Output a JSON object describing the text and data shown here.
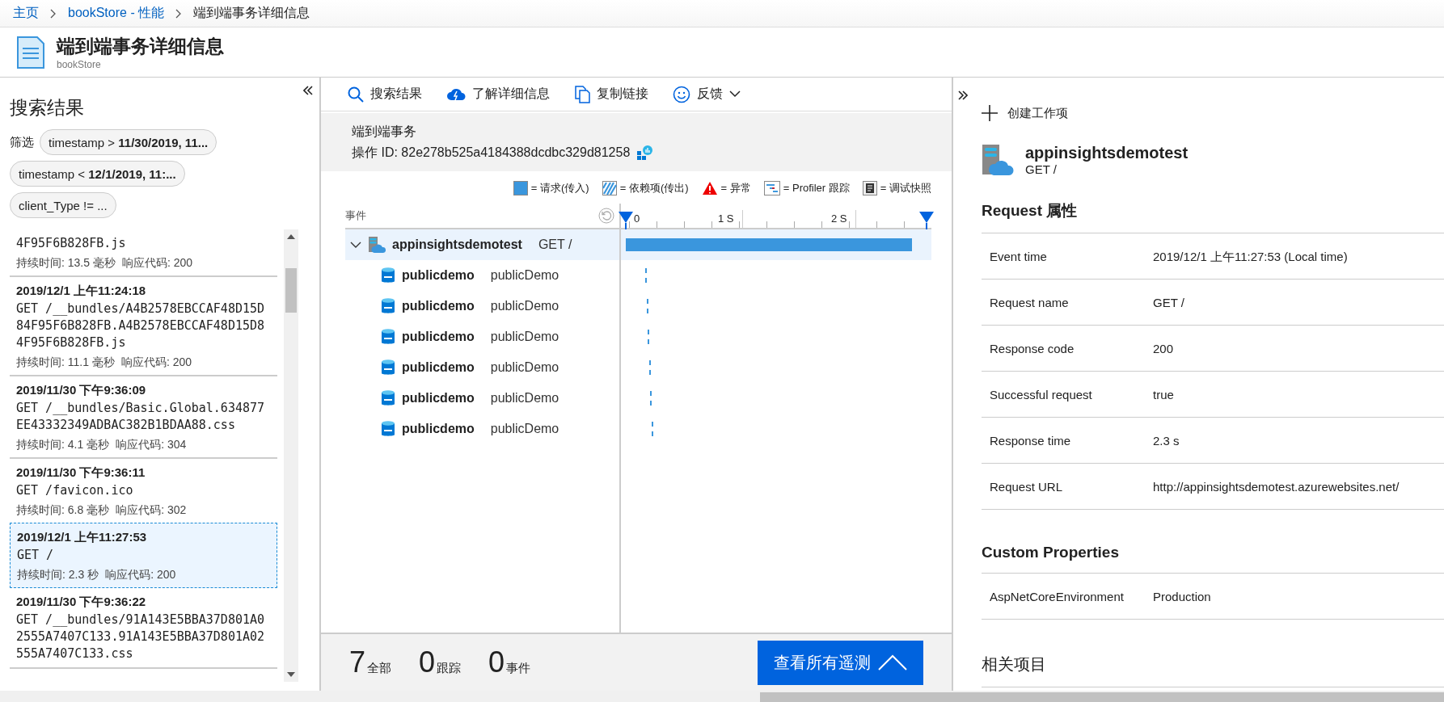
{
  "breadcrumb": [
    {
      "label": "主页",
      "kind": "link"
    },
    {
      "label": "bookStore - 性能",
      "kind": "link"
    },
    {
      "label": "端到端事务详细信息",
      "kind": "current"
    }
  ],
  "header": {
    "title": "端到端事务详细信息",
    "subtitle": "bookStore"
  },
  "search_panel": {
    "title": "搜索结果",
    "filter_label": "筛选",
    "filters": [
      "timestamp > **11/30/2019, 11...**",
      "timestamp < **12/1/2019, 11:...**",
      "client_Type != ..."
    ],
    "results": [
      {
        "request": "4F95F6B828FB.js",
        "duration": "持续时间: 13.5 毫秒",
        "code": "响应代码: 200",
        "selected": false
      },
      {
        "time": "2019/12/1 上午11:24:18",
        "request": "GET /__bundles/A4B2578EBCCAF48D15D84F95F6B828FB.A4B2578EBCCAF48D15D84F95F6B828FB.js",
        "duration": "持续时间: 11.1 毫秒",
        "code": "响应代码: 200",
        "selected": false
      },
      {
        "time": "2019/11/30 下午9:36:09",
        "request": "GET /__bundles/Basic.Global.634877EE43332349ADBAC382B1BDAA88.css",
        "duration": "持续时间: 4.1 毫秒",
        "code": "响应代码: 304",
        "selected": false
      },
      {
        "time": "2019/11/30 下午9:36:11",
        "request": "GET /favicon.ico",
        "duration": "持续时间: 6.8 毫秒",
        "code": "响应代码: 302",
        "selected": false
      },
      {
        "time": "2019/12/1 上午11:27:53",
        "request": "GET /",
        "duration": "持续时间: 2.3 秒",
        "code": "响应代码: 200",
        "selected": true
      },
      {
        "time": "2019/11/30 下午9:36:22",
        "request": "GET /__bundles/91A143E5BBA37D801A02555A7407C133.91A143E5BBA37D801A02555A7407C133.css",
        "selected": false
      }
    ]
  },
  "toolbar": [
    {
      "kind": "search",
      "label": "搜索结果"
    },
    {
      "kind": "learn",
      "label": "了解详细信息"
    },
    {
      "kind": "copy",
      "label": "复制链接"
    },
    {
      "kind": "feedback",
      "label": "反馈"
    }
  ],
  "transaction": {
    "title": "端到端事务",
    "operation_id": "操作 ID: 82e278b525a4184388dcdbc329d81258"
  },
  "legend": [
    {
      "kind": "request",
      "label": "= 请求(传入)"
    },
    {
      "kind": "dependency",
      "label": "= 依赖项(传出)"
    },
    {
      "kind": "exception",
      "label": "= 异常"
    },
    {
      "kind": "profiler",
      "label": "= Profiler 跟踪"
    },
    {
      "kind": "snapshot",
      "label": "= 调试快照"
    }
  ],
  "timeline": {
    "column": "事件",
    "ticks": [
      "0",
      "1 S",
      "2 S"
    ],
    "rows": [
      {
        "kind": "app",
        "name": "appinsightsdemotest",
        "detail": "GET /",
        "expanded": true,
        "selected": true,
        "level": 1,
        "children": [
          {
            "kind": "sql",
            "name": "publicdemo",
            "detail": "publicDemo"
          },
          {
            "kind": "sql",
            "name": "publicdemo",
            "detail": "publicDemo"
          },
          {
            "kind": "sql",
            "name": "publicdemo",
            "detail": "publicDemo"
          },
          {
            "kind": "sql",
            "name": "publicdemo",
            "detail": "publicDemo"
          },
          {
            "kind": "sql",
            "name": "publicdemo",
            "detail": "publicDemo"
          },
          {
            "kind": "sql",
            "name": "publicdemo",
            "detail": "publicDemo"
          }
        ]
      }
    ]
  },
  "footer": {
    "counts": [
      {
        "value": "7",
        "label": "全部"
      },
      {
        "value": "0",
        "label": "跟踪"
      },
      {
        "value": "0",
        "label": "事件"
      }
    ],
    "button": "查看所有遥测"
  },
  "details": {
    "create": "创建工作项",
    "name": "appinsightsdemotest",
    "detail": "GET /",
    "sections": [
      {
        "title": "Request 属性",
        "rows": [
          [
            "Event time",
            "2019/12/1 上午11:27:53 (Local time)"
          ],
          [
            "Request name",
            "GET /"
          ],
          [
            "Response code",
            "200"
          ],
          [
            "Successful request",
            "true"
          ],
          [
            "Response time",
            "2.3 s"
          ],
          [
            "Request URL",
            "http://appinsightsdemotest.azurewebsites.net/"
          ]
        ]
      },
      {
        "title": "Custom Properties",
        "rows": [
          [
            "AspNetCoreEnvironment",
            "Production"
          ]
        ]
      },
      {
        "title": "相关项目"
      }
    ]
  }
}
